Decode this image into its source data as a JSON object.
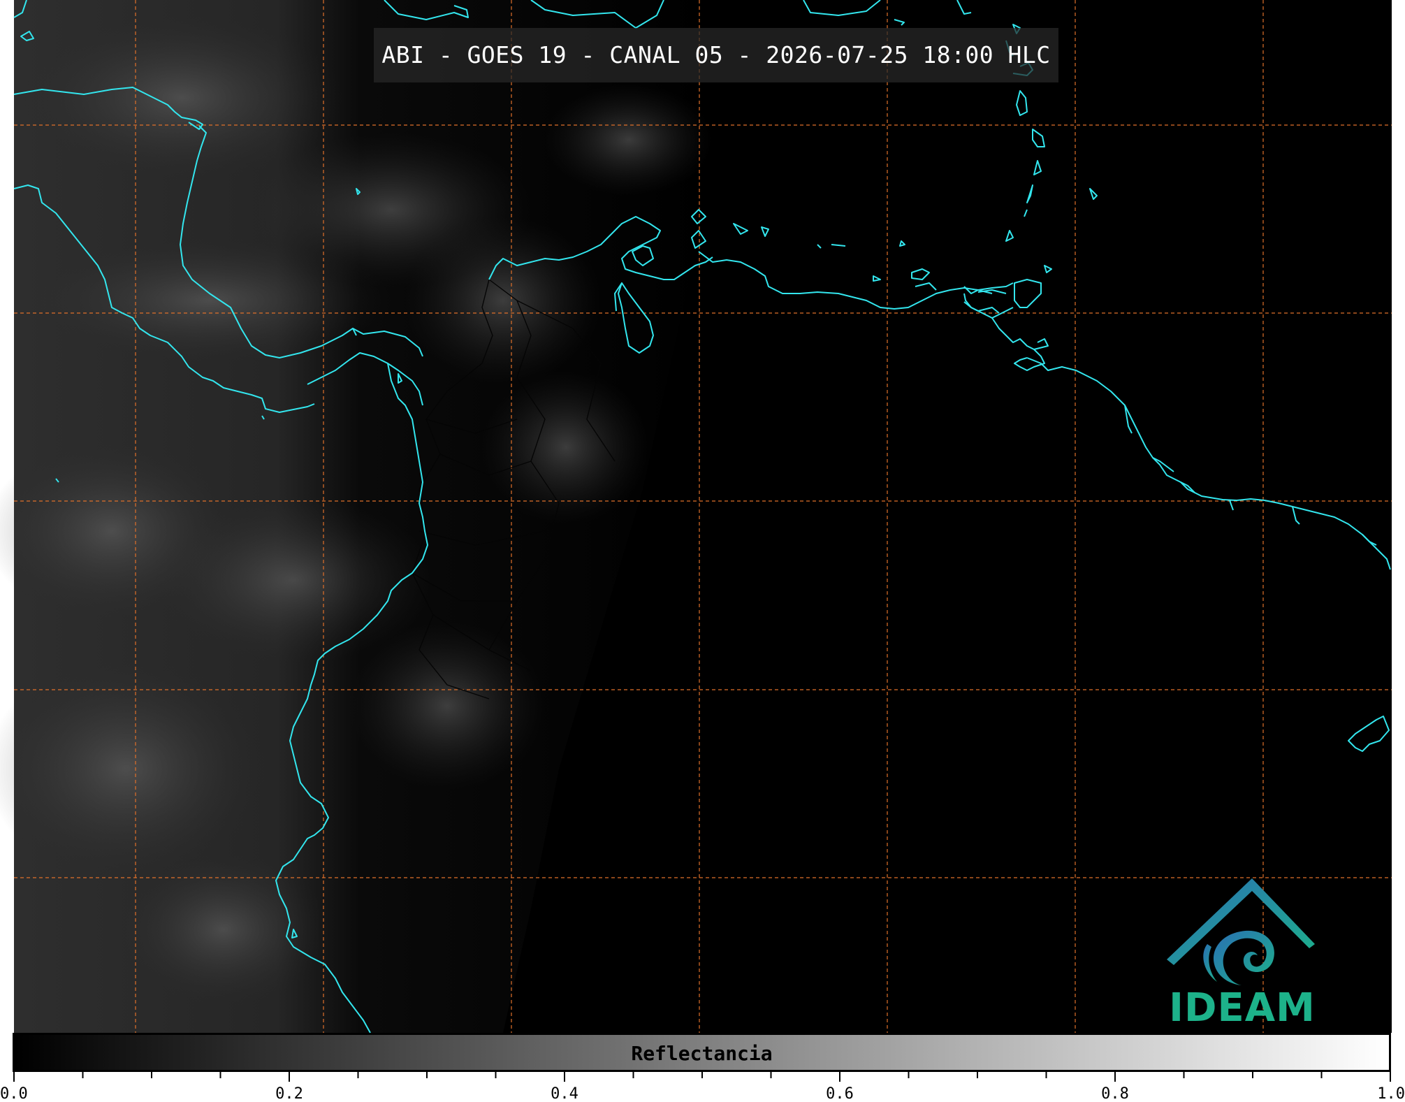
{
  "map": {
    "title": "ABI - GOES 19 - CANAL 05 - 2026-07-25 18:00 HLC",
    "colors": {
      "coastline": "#33e6ee",
      "graticule": "#e0702a",
      "borders": "#000000",
      "land_dark": "#1f1f1f",
      "sea": "#000000"
    }
  },
  "colorbar": {
    "label": "Reflectancia",
    "ticks": [
      "0.0",
      "0.2",
      "0.4",
      "0.6",
      "0.8",
      "1.0"
    ],
    "range": [
      0.0,
      1.0
    ],
    "colors": {
      "start": "#000000",
      "end": "#ffffff"
    }
  },
  "logo": {
    "text": "IDEAM",
    "colors": {
      "primary": "#1db28a",
      "secondary": "#2a6fb4"
    }
  }
}
